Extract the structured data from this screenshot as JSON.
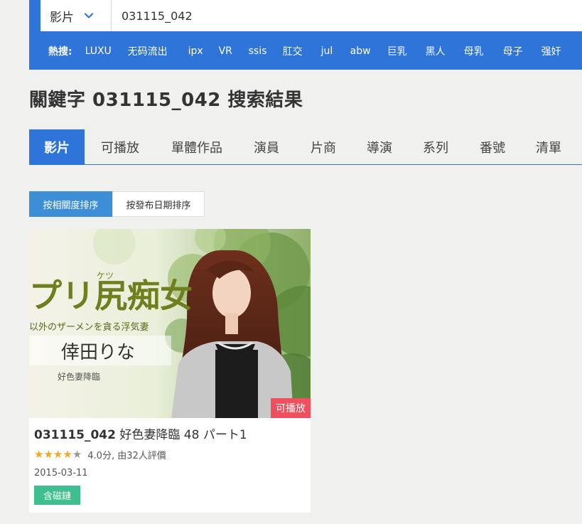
{
  "search": {
    "category": "影片",
    "query": "031115_042"
  },
  "hot": {
    "label": "熱搜:",
    "items": [
      "LUXU",
      "无码流出",
      "ipx",
      "VR",
      "ssis",
      "肛交",
      "jul",
      "abw",
      "巨乳",
      "黑人",
      "母乳",
      "母子",
      "强奸"
    ]
  },
  "page_title": "關鍵字 031115_042 搜索結果",
  "tabs": [
    {
      "label": "影片",
      "active": true
    },
    {
      "label": "可播放"
    },
    {
      "label": "單體作品"
    },
    {
      "label": "演員"
    },
    {
      "label": "片商"
    },
    {
      "label": "導演"
    },
    {
      "label": "系列"
    },
    {
      "label": "番號"
    },
    {
      "label": "清單"
    }
  ],
  "sort": {
    "relevance": "按相關度排序",
    "date": "按發布日期排序"
  },
  "card": {
    "code": "031115_042",
    "title": "好色妻降臨 48 パート1",
    "rating_value": 4.0,
    "rating_text": "4.0分, 由32人評價",
    "date": "2015-03-11",
    "playable_badge": "可播放",
    "magnet_tag": "含磁鏈",
    "poster": {
      "title_main": "プリ尻痴女",
      "ruby": "ケツ",
      "subtitle": "以外のザーメンを貪る浮気妻",
      "actress": "倖田りな",
      "brand": "好色妻降臨"
    }
  },
  "colors": {
    "primary": "#2f74d9",
    "sort_active": "#3c8fd6",
    "play_badge": "#f0505e",
    "magnet": "#3fbf8f",
    "star": "#f5a623"
  }
}
